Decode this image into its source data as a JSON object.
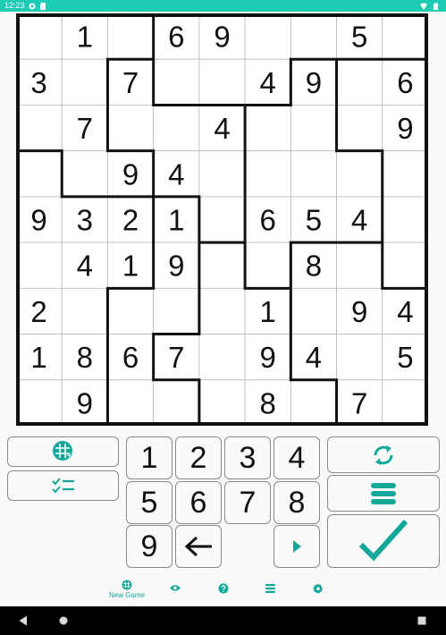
{
  "status_bar": {
    "time": "12:23"
  },
  "puzzle": {
    "cells": [
      [
        "",
        "1",
        "",
        "6",
        "9",
        "",
        "",
        "5",
        ""
      ],
      [
        "3",
        "",
        "7",
        "",
        "",
        "4",
        "9",
        "",
        "6"
      ],
      [
        "",
        "7",
        "",
        "",
        "4",
        "",
        "",
        "",
        "9"
      ],
      [
        "",
        "",
        "9",
        "4",
        "",
        "",
        "",
        "",
        ""
      ],
      [
        "9",
        "3",
        "2",
        "1",
        "",
        "6",
        "5",
        "4",
        ""
      ],
      [
        "",
        "4",
        "1",
        "9",
        "",
        "",
        "8",
        "",
        ""
      ],
      [
        "2",
        "",
        "",
        "",
        "",
        "1",
        "",
        "9",
        "4"
      ],
      [
        "1",
        "8",
        "6",
        "7",
        "",
        "9",
        "4",
        "",
        "5"
      ],
      [
        "",
        "9",
        "",
        "",
        "",
        "8",
        "",
        "7",
        ""
      ]
    ],
    "regions": [
      [
        0,
        0,
        0,
        1,
        1,
        1,
        1,
        1,
        1
      ],
      [
        0,
        0,
        2,
        1,
        1,
        1,
        3,
        4,
        4
      ],
      [
        0,
        0,
        2,
        2,
        2,
        3,
        3,
        4,
        4
      ],
      [
        5,
        0,
        0,
        2,
        2,
        3,
        3,
        3,
        4
      ],
      [
        5,
        5,
        5,
        6,
        2,
        3,
        3,
        3,
        4
      ],
      [
        5,
        5,
        5,
        6,
        7,
        3,
        8,
        8,
        4
      ],
      [
        5,
        5,
        6,
        6,
        7,
        7,
        8,
        8,
        8
      ],
      [
        5,
        5,
        6,
        7,
        7,
        7,
        8,
        8,
        8
      ],
      [
        5,
        5,
        6,
        6,
        7,
        7,
        7,
        8,
        8
      ]
    ]
  },
  "controls": {
    "digits": [
      "1",
      "2",
      "3",
      "4",
      "5",
      "6",
      "7",
      "8",
      "9"
    ]
  },
  "accent_color": "#13a89a",
  "bottom_nav": {
    "new_game_label": "New Game"
  }
}
